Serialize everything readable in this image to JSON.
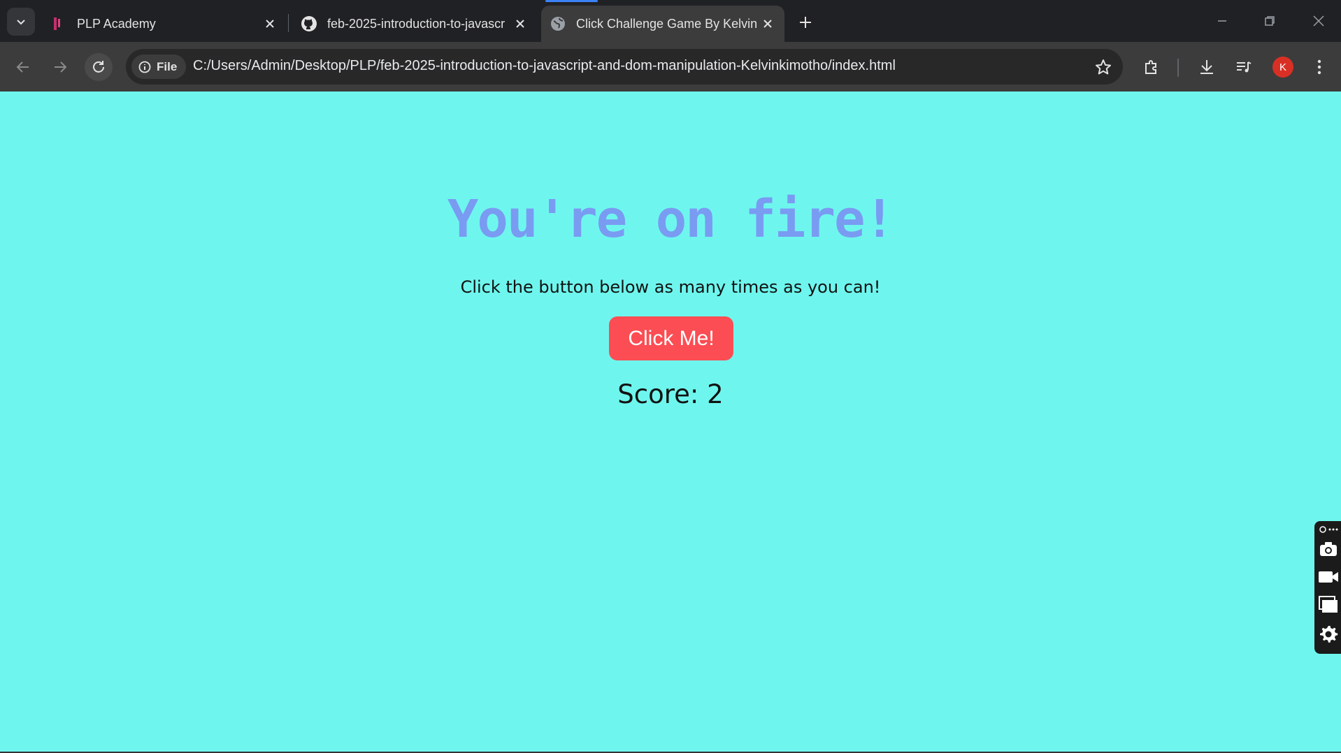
{
  "browser": {
    "tabs": [
      {
        "label": "PLP Academy",
        "icon": "plp-logo-icon"
      },
      {
        "label": "feb-2025-introduction-to-javascr",
        "icon": "github-icon"
      },
      {
        "label": "Click Challenge Game By Kelvin",
        "icon": "globe-icon",
        "active": true
      }
    ],
    "new_tab_label": "+",
    "site_chip_label": "File",
    "url": "C:/Users/Admin/Desktop/PLP/feb-2025-introduction-to-javascript-and-dom-manipulation-Kelvinkimotho/index.html",
    "profile_initial": "K"
  },
  "page": {
    "title": "You're on fire!",
    "subtitle": "Click the button below as many times as you can!",
    "button_label": "Click Me!",
    "score_text": "Score: 2"
  },
  "colors": {
    "page_background": "#6ef6ee",
    "title": "#7a9bf2",
    "button": "#fb4d53"
  }
}
